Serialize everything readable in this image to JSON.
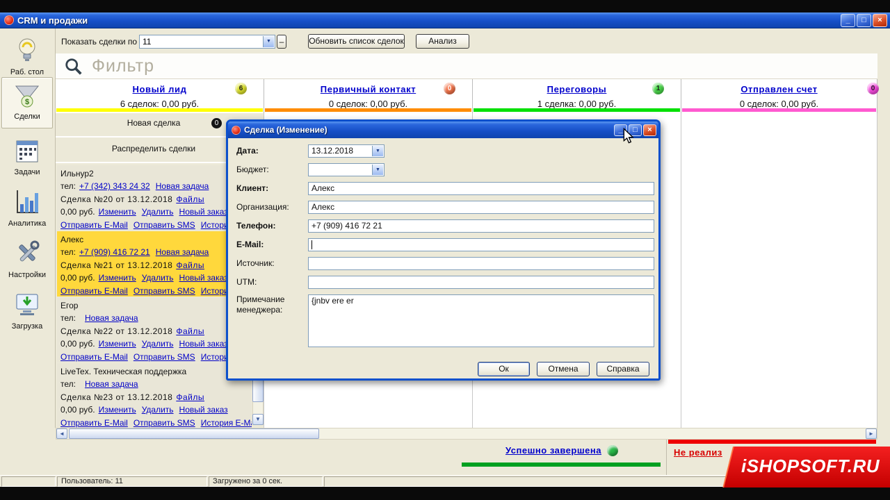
{
  "window": {
    "title": "CRM и продажи",
    "controls": {
      "minimize": "_",
      "maximize": "□",
      "close": "×"
    }
  },
  "toolbar": {
    "show_label": "Показать сделки по",
    "show_value": "11",
    "minus_button": "–",
    "refresh_button": "Обновить список сделок",
    "analysis_button": "Анализ"
  },
  "filter": {
    "placeholder": "Фильтр"
  },
  "sidebar": {
    "items": [
      {
        "label": "Раб. стол"
      },
      {
        "label": "Сделки"
      },
      {
        "label": "Задачи"
      },
      {
        "label": "Аналитика"
      },
      {
        "label": "Настройки"
      },
      {
        "label": "Загрузка"
      }
    ]
  },
  "kanban": {
    "columns": [
      {
        "title": "Новый лид",
        "badge": "6",
        "summary": "6 сделок: 0,00 руб.",
        "badge_color": "#dde22e",
        "bar_color": "#ffff00"
      },
      {
        "title": "Первичный контакт",
        "badge": "0",
        "summary": "0 сделок: 0,00 руб.",
        "badge_color": "#f4744a",
        "bar_color": "#ff8c00"
      },
      {
        "title": "Переговоры",
        "badge": "1",
        "summary": "1 сделка: 0,00 руб.",
        "badge_color": "#4ad84a",
        "bar_color": "#00e000"
      },
      {
        "title": "Отправлен счет",
        "badge": "0",
        "summary": "0 сделок: 0,00 руб.",
        "badge_color": "#f84ae0",
        "bar_color": "#ff5ad0"
      }
    ]
  },
  "deals": {
    "new_deal": "Новая сделка",
    "new_deal_badge": "0",
    "distribute": "Распределить сделки",
    "labels": {
      "tel": "тел:",
      "new_task": "Новая задача",
      "files": "Файлы",
      "edit": "Изменить",
      "del": "Удалить",
      "new_order": "Новый заказ",
      "send_email": "Отправить E-Mail",
      "send_sms": "Отправить SMS",
      "history": "История E-Mail"
    },
    "cards": [
      {
        "name": "Ильнур2",
        "phone": "+7 (342) 343 24 32",
        "deal_info": "Сделка №20 от 13.12.2018",
        "amount": "0,00 руб."
      },
      {
        "name": "Алекс",
        "phone": "+7 (909) 416 72 21",
        "deal_info": "Сделка №21 от 13.12.2018",
        "amount": "0,00 руб."
      },
      {
        "name": "Егор",
        "phone": "",
        "deal_info": "Сделка №22 от 13.12.2018",
        "amount": "0,00 руб."
      },
      {
        "name": "LiveTex. Техническая поддержка",
        "phone": "",
        "deal_info": "Сделка №23 от 13.12.2018",
        "amount": "0,00 руб."
      }
    ]
  },
  "dialog": {
    "title": "Сделка  (Изменение)",
    "labels": {
      "date": "Дата:",
      "budget": "Бюджет:",
      "client": "Клиент:",
      "org": "Организация:",
      "phone": "Телефон:",
      "email": "E-Mail:",
      "source": "Источник:",
      "utm": "UTM:",
      "note": "Примечание менеджера:"
    },
    "values": {
      "date": "13.12.2018",
      "budget": "",
      "client": "Алекс",
      "org": "Алекс",
      "phone": "+7 (909) 416 72 21",
      "email": "",
      "source": "",
      "utm": "",
      "note": "{jnbv ere er"
    },
    "buttons": {
      "ok": "Ок",
      "cancel": "Отмена",
      "help": "Справка"
    }
  },
  "bottom": {
    "done": {
      "title": "Успешно завершена",
      "bar_color": "#00a020",
      "badge_color": "#28b848"
    },
    "failed": {
      "title": "Не реализ",
      "bar_color": "#ee0000",
      "text_color": "#d80000"
    },
    "watermark": {
      "text": "iSHOPSOFT.RU",
      "color": "#d40000"
    }
  },
  "statusbar": {
    "user": "Пользователь: 11",
    "loaded": "Загружено за 0 сек."
  }
}
